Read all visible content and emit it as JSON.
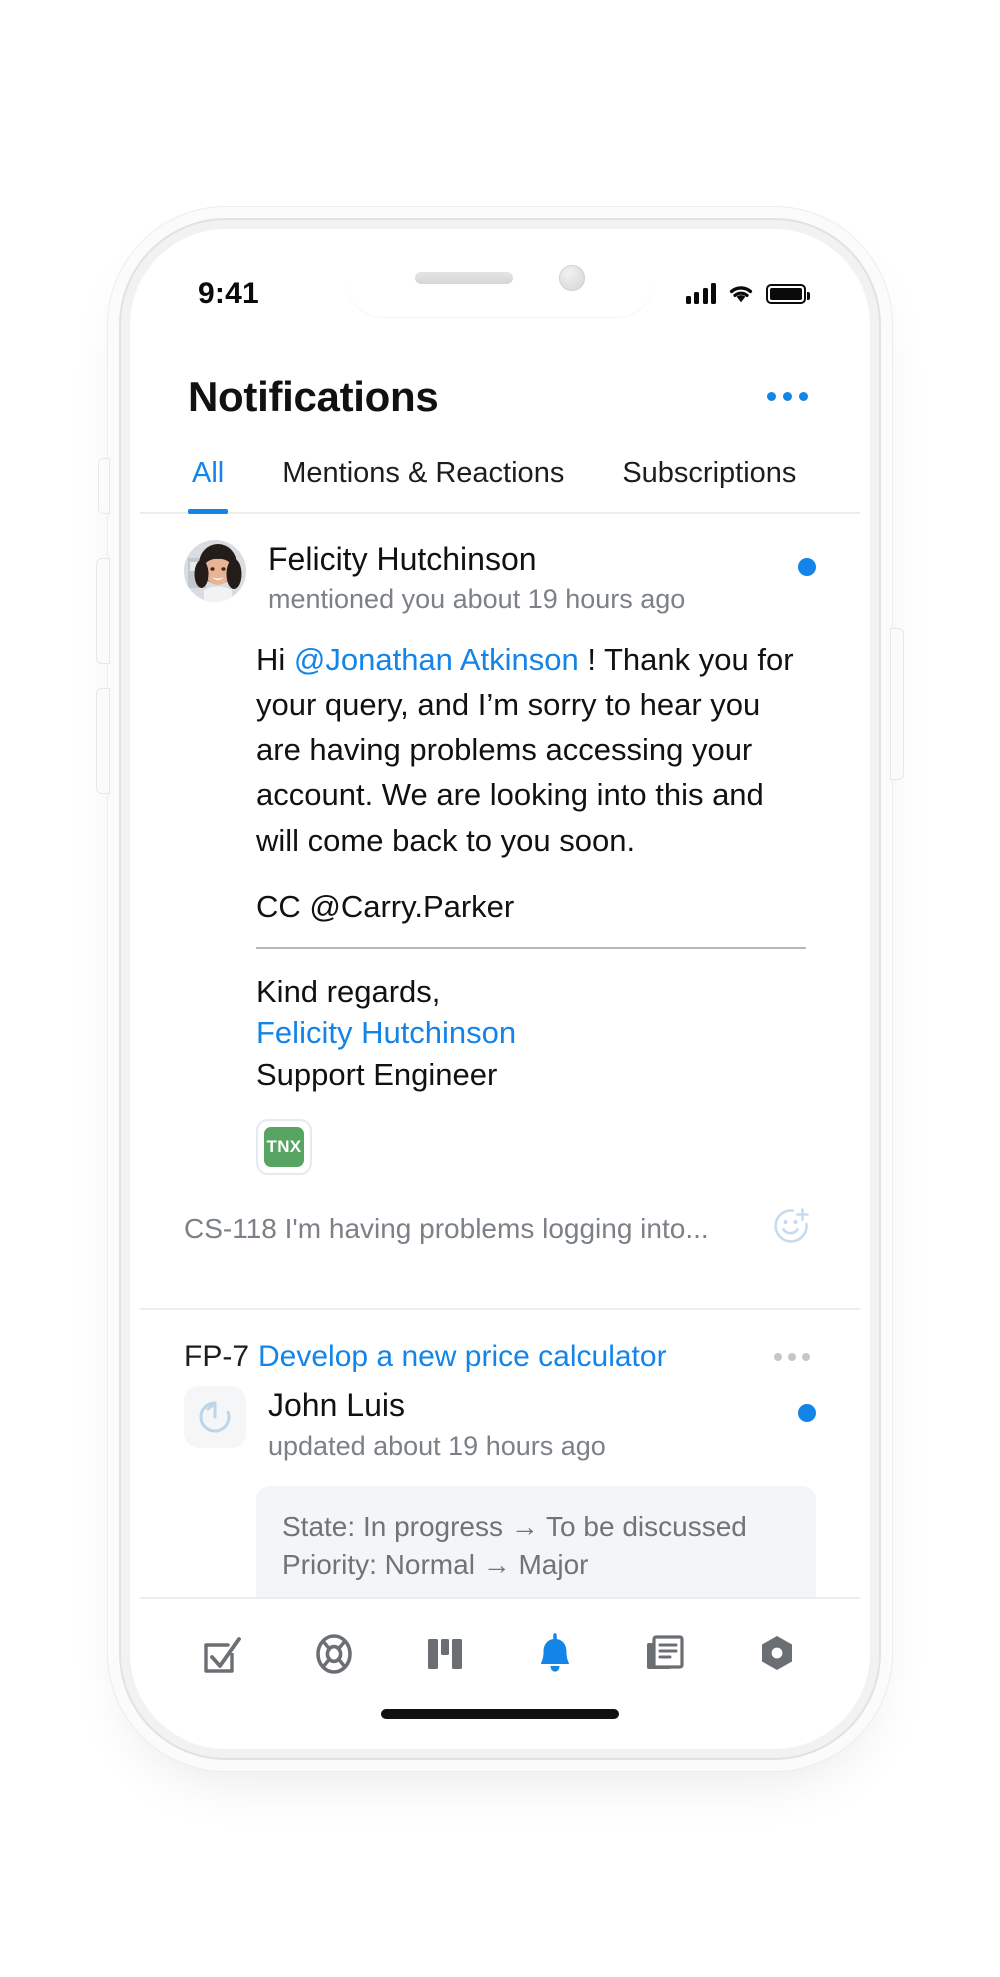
{
  "status_bar": {
    "time": "9:41",
    "cellular_icon": "cellular-bars-icon",
    "wifi_icon": "wifi-icon",
    "battery_icon": "battery-full-icon"
  },
  "header": {
    "title": "Notifications",
    "more_icon": "more-horizontal-icon"
  },
  "tabs": [
    {
      "label": "All",
      "active": true
    },
    {
      "label": "Mentions & Reactions",
      "active": false
    },
    {
      "label": "Subscriptions",
      "active": false
    }
  ],
  "notifications": [
    {
      "author": "Felicity Hutchinson",
      "action": "mentioned you about 19 hours ago",
      "unread": true,
      "avatar_icon": "user-photo-avatar",
      "message": {
        "greeting": "Hi ",
        "mention": "@Jonathan Atkinson",
        "rest": " ! Thank you for your query, and I’m sorry to hear you are having problems accessing your account. We are looking into this and will come back to you soon.",
        "cc": "CC @Carry.Parker",
        "signoff": "Kind regards,",
        "signer": "Felicity Hutchinson",
        "role": "Support Engineer"
      },
      "attachment_badge": "TNX",
      "footer_text": "CS-118 I'm having problems logging into...",
      "react_icon": "add-reaction-icon"
    },
    {
      "issue_id": "FP-7",
      "issue_title": "Develop a new price calculator",
      "more_icon": "more-horizontal-icon",
      "author": "John Luis",
      "action": "updated about 19 hours ago",
      "unread": true,
      "type_icon": "update-refresh-icon",
      "changes": [
        "State:  In progress → To be discussed",
        "Priority:  Normal → Major"
      ]
    }
  ],
  "tabbar": [
    {
      "icon": "tasks-checkbox-icon",
      "active": false
    },
    {
      "icon": "agile-lifebuoy-icon",
      "active": false
    },
    {
      "icon": "board-columns-icon",
      "active": false
    },
    {
      "icon": "bell-notifications-icon",
      "active": true
    },
    {
      "icon": "articles-document-icon",
      "active": false
    },
    {
      "icon": "settings-hexagon-icon",
      "active": false
    }
  ],
  "colors": {
    "accent": "#1384e8",
    "text_primary": "#111111",
    "text_muted": "#7c8187",
    "badge_green": "#57a463",
    "icon_inactive": "#6b6f73"
  }
}
